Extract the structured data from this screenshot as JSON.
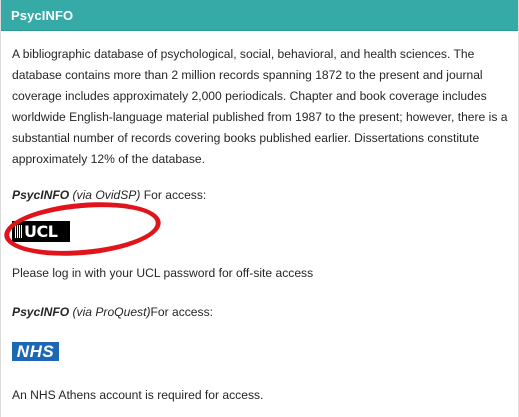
{
  "header": {
    "title": "PsycINFO"
  },
  "description": "A bibliographic database of psychological, social, behavioral, and health sciences. The database contains more than 2 million records spanning 1872 to the present and journal coverage includes approximately 2,000 periodicals. Chapter and book coverage includes worldwide English-language material published from 1987 to the present; however, there is a substantial number of records covering books published earlier. Dissertations constitute approximately 12% of the database.",
  "ovid": {
    "name": "PsycINFO",
    "via": "(via OvidSP)",
    "access": " For access:",
    "logo_text": "UCL",
    "logo_icon": "ucl-portico-icon",
    "highlight_color": "#e1141c",
    "note": "Please log in with your UCL password for off-site access"
  },
  "proquest": {
    "name": "PsycINFO",
    "via": "(via ProQuest)",
    "access": "For access:",
    "logo_text": "NHS",
    "logo_color": "#1d68b5",
    "note": "An NHS Athens account is required for access."
  },
  "colors": {
    "header_bg": "#36aaa6",
    "header_text": "#ffffff"
  }
}
